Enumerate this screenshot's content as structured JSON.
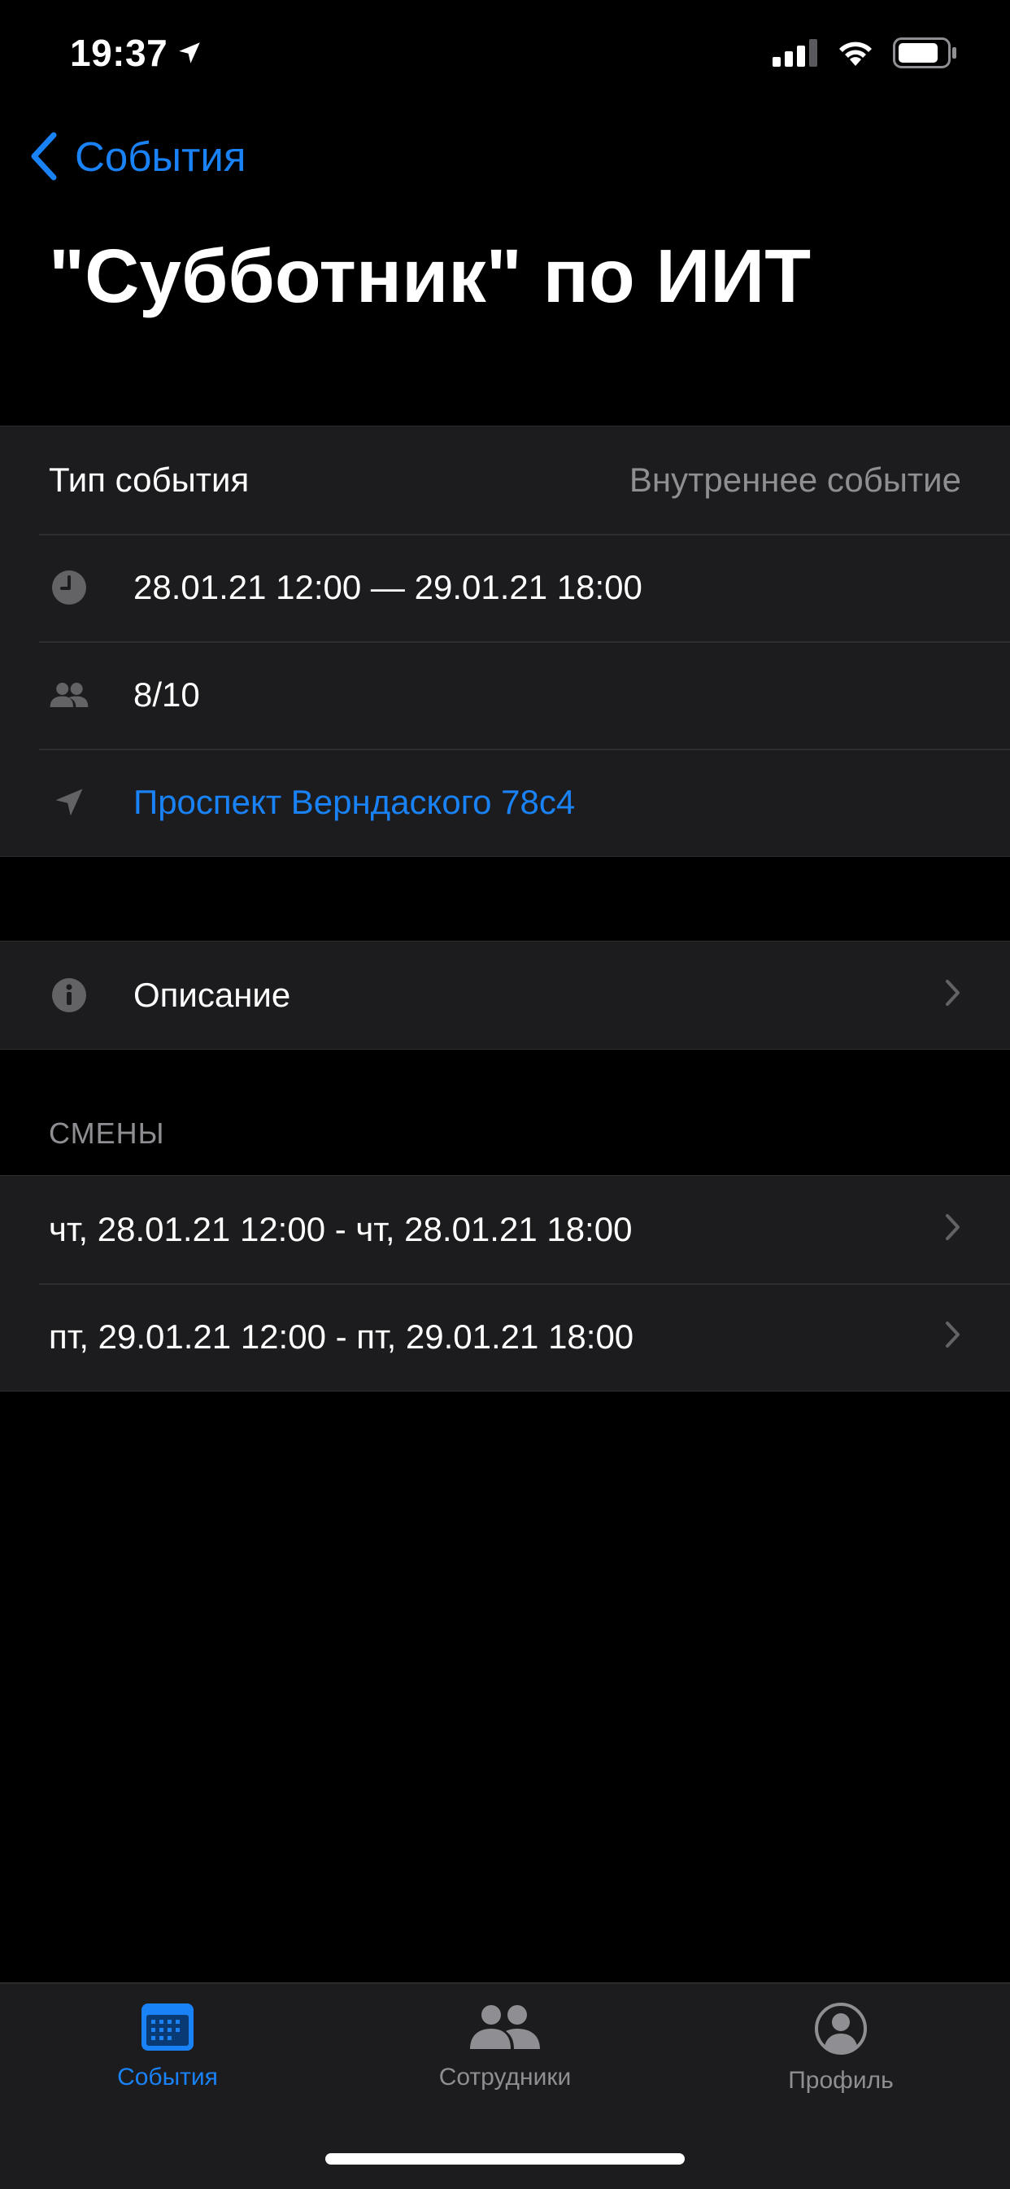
{
  "status_bar": {
    "time": "19:37"
  },
  "nav": {
    "back_label": "События"
  },
  "title": "\"Субботник\" по ИИТ",
  "info": {
    "event_type_label": "Тип события",
    "event_type_value": "Внутреннее событие",
    "datetime": "28.01.21 12:00 — 29.01.21 18:00",
    "participants": "8/10",
    "address": "Проспект Верндаского 78с4"
  },
  "description": {
    "label": "Описание"
  },
  "shifts": {
    "header": "СМЕНЫ",
    "items": [
      {
        "label": "чт, 28.01.21 12:00 - чт, 28.01.21 18:00"
      },
      {
        "label": "пт, 29.01.21 12:00 - пт, 29.01.21 18:00"
      }
    ]
  },
  "tabbar": {
    "tabs": [
      {
        "label": "События",
        "icon": "calendar-icon",
        "active": true
      },
      {
        "label": "Сотрудники",
        "icon": "people-icon",
        "active": false
      },
      {
        "label": "Профиль",
        "icon": "profile-icon",
        "active": false
      }
    ]
  },
  "colors": {
    "accent": "#1a82f7",
    "background": "#000000",
    "cell": "#1c1c1e",
    "secondary_text": "#8e8e93"
  }
}
